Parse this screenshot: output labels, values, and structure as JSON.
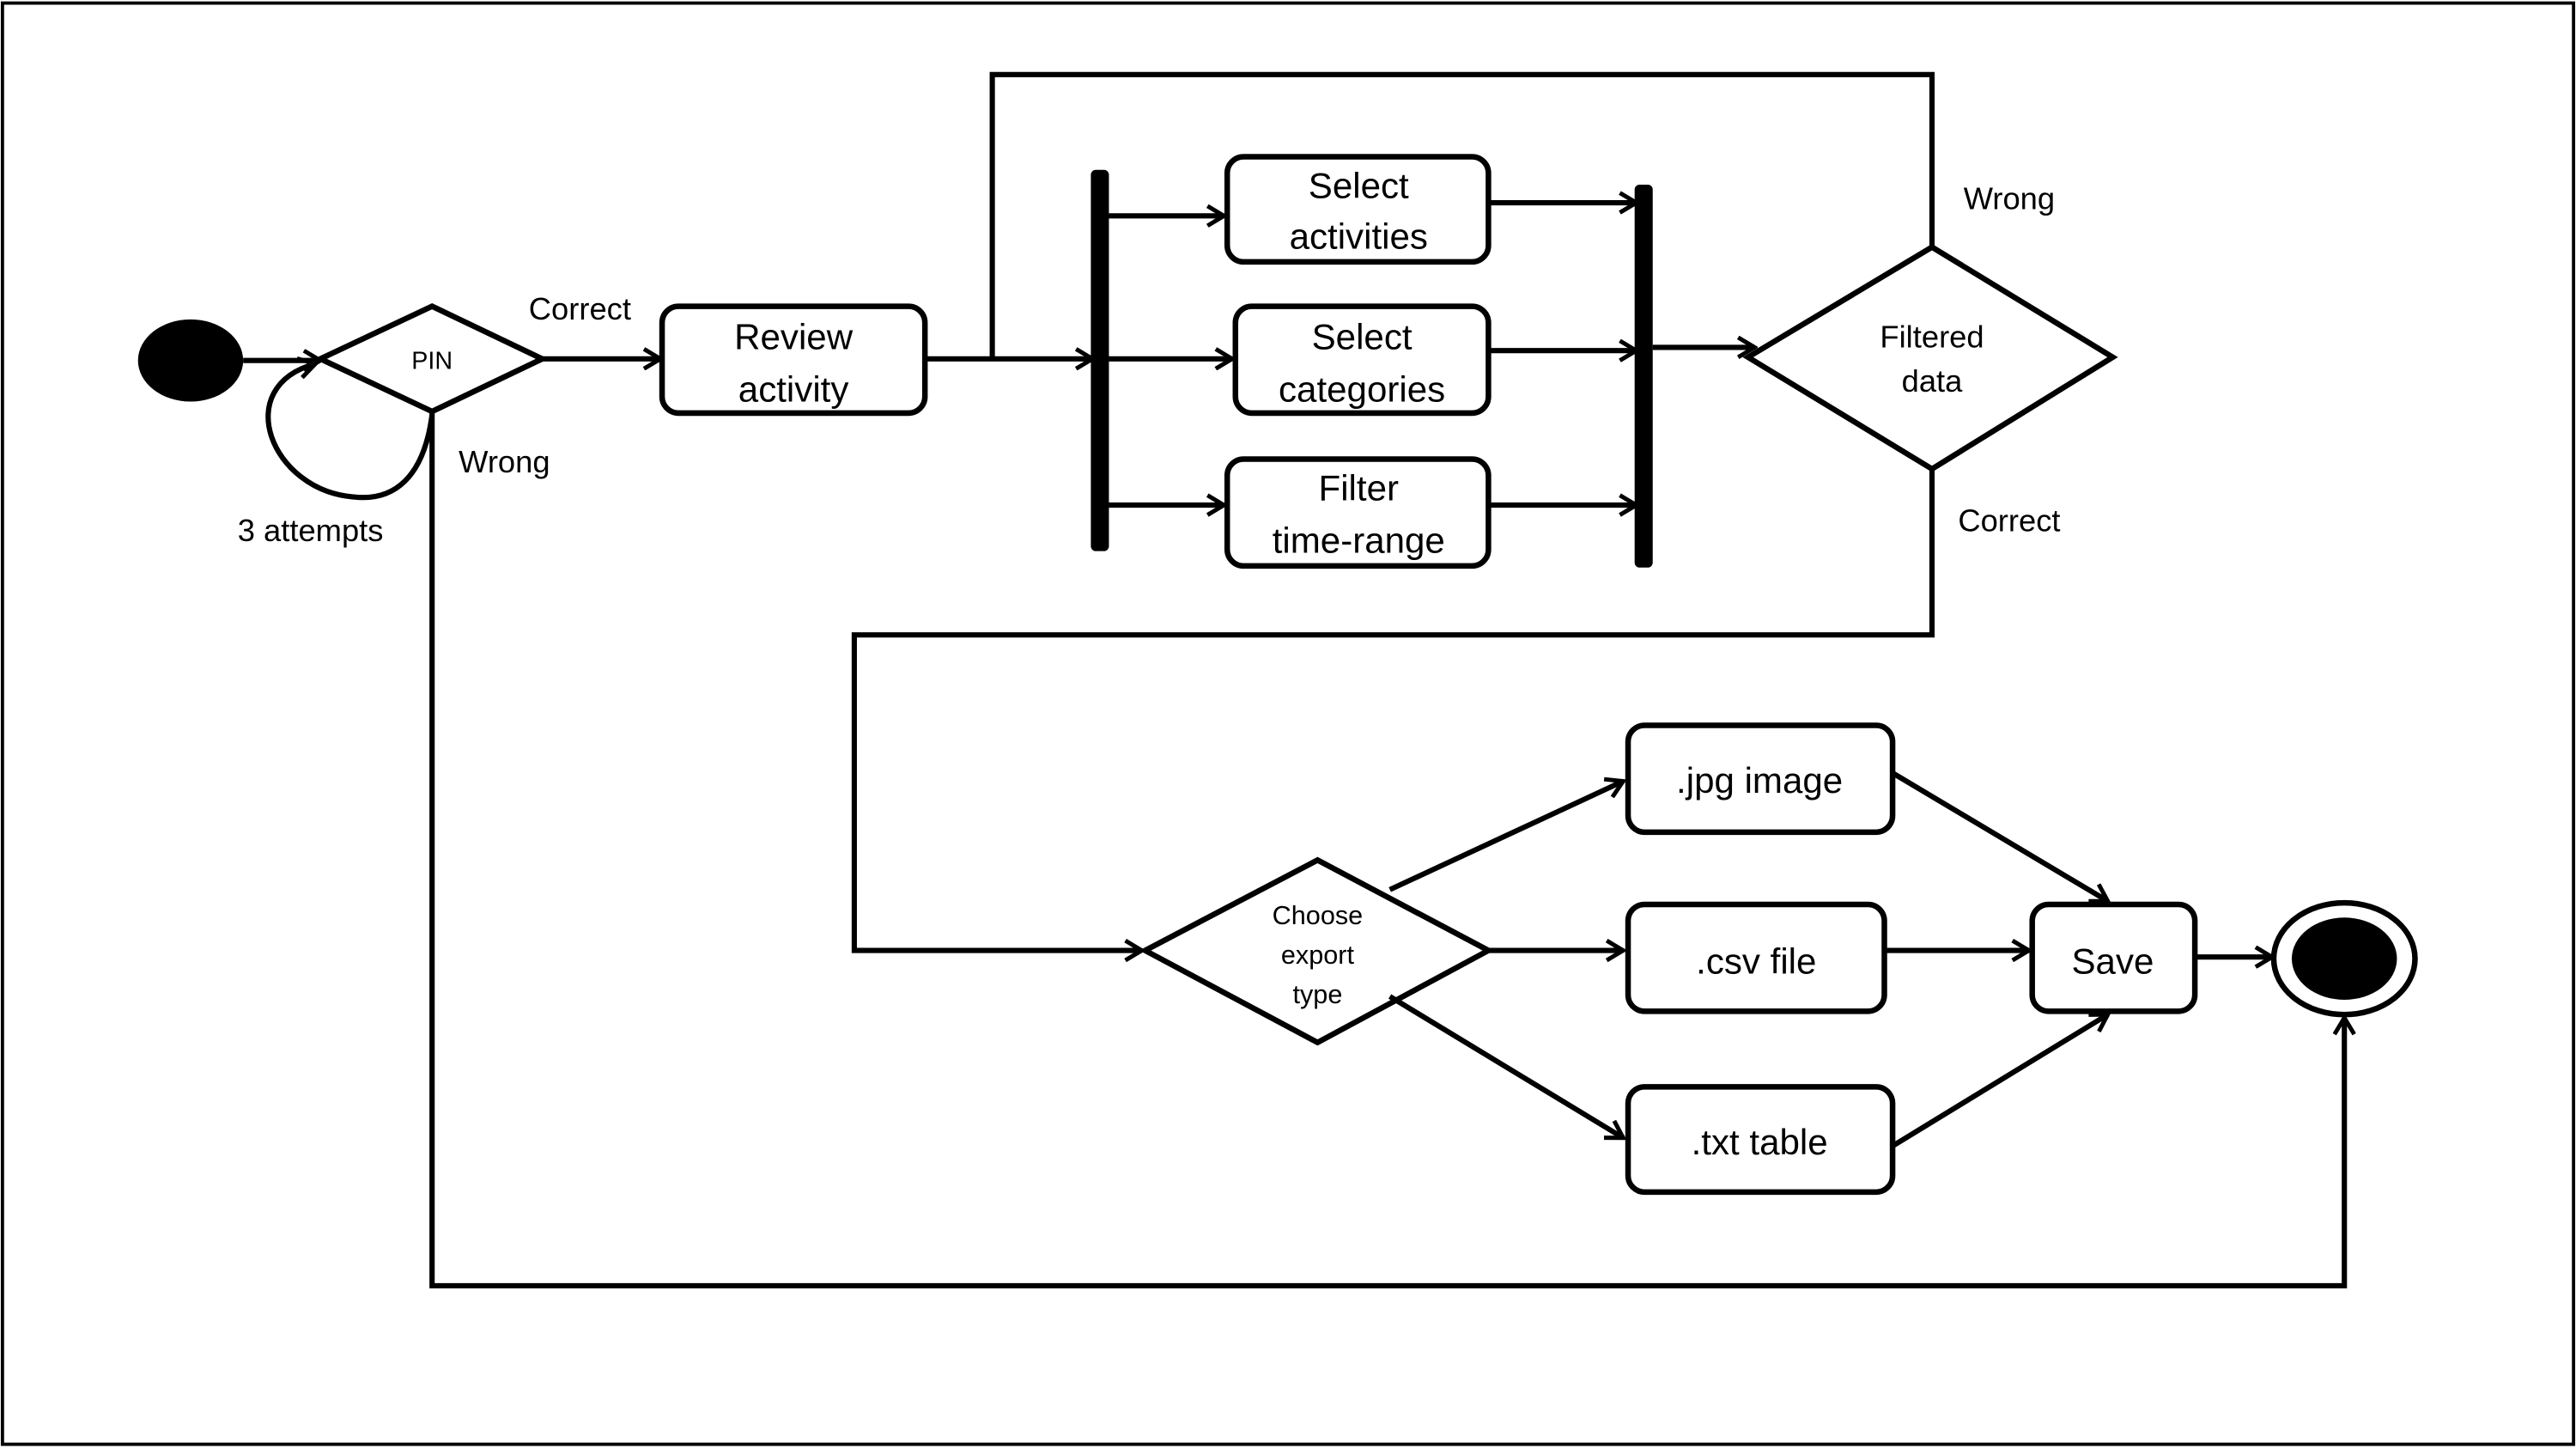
{
  "diagram": {
    "decisions": {
      "pin": "PIN",
      "filtered_data": [
        "Filtered",
        "data"
      ],
      "export_type": [
        "Choose",
        "export",
        "type"
      ]
    },
    "activities": {
      "review": [
        "Review",
        "activity"
      ],
      "select_activities": [
        "Select",
        "activities"
      ],
      "select_categories": [
        "Select",
        "categories"
      ],
      "filter_time_range": [
        "Filter",
        "time-range"
      ],
      "jpg": ".jpg image",
      "csv": ".csv file",
      "txt": ".txt table",
      "save": "Save"
    },
    "guards": {
      "pin_correct": "Correct",
      "pin_wrong": "Wrong",
      "pin_loop": "3 attempts",
      "filter_wrong": "Wrong",
      "filter_correct": "Correct"
    }
  }
}
